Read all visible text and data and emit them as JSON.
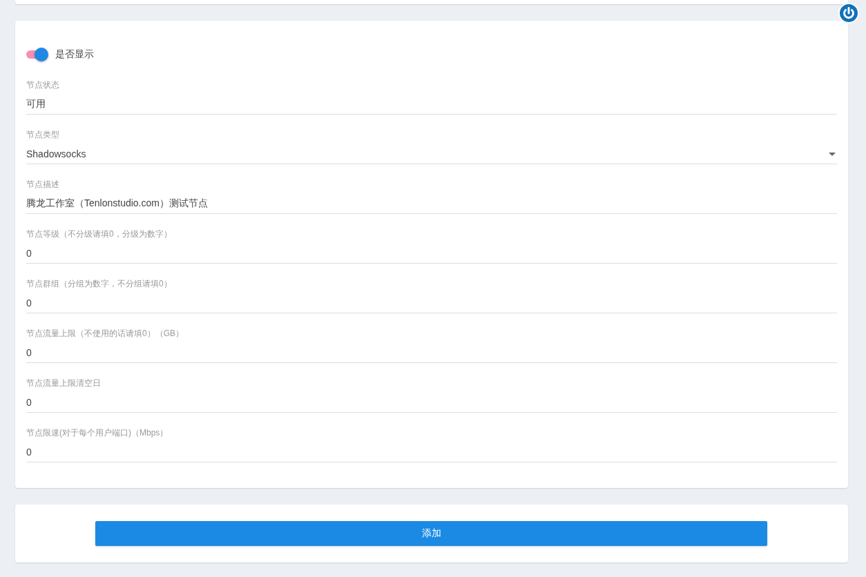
{
  "display_toggle": {
    "label": "是否显示",
    "on": true
  },
  "fields": [
    {
      "kind": "text",
      "label": "节点状态",
      "value": "可用"
    },
    {
      "kind": "select",
      "label": "节点类型",
      "value": "Shadowsocks"
    },
    {
      "kind": "text",
      "label": "节点描述",
      "value": "腾龙工作室（Tenlonstudio.com）测试节点"
    },
    {
      "kind": "text",
      "label": "节点等级（不分级请填0，分级为数字）",
      "value": "0"
    },
    {
      "kind": "text",
      "label": "节点群组（分组为数字，不分组请填0）",
      "value": "0"
    },
    {
      "kind": "text",
      "label": "节点流量上限（不使用的话请填0）（GB）",
      "value": "0"
    },
    {
      "kind": "text",
      "label": "节点流量上限清空日",
      "value": "0"
    },
    {
      "kind": "text",
      "label": "节点限速(对于每个用户端口)（Mbps）",
      "value": "0"
    }
  ],
  "submit_button": "添加"
}
